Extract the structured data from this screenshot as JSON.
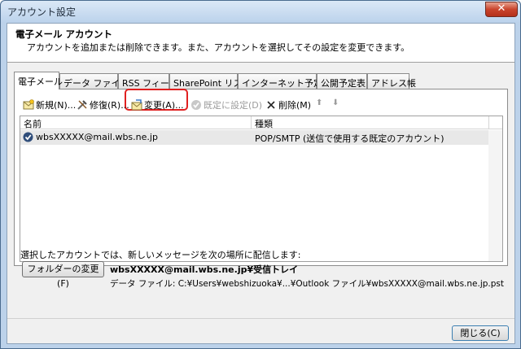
{
  "window": {
    "title": "アカウント設定",
    "close_glyph": "✕"
  },
  "header": {
    "title": "電子メール アカウント",
    "description": "アカウントを追加または削除できます。また、アカウントを選択してその設定を変更できます。"
  },
  "tabs": [
    {
      "label": "電子メール",
      "active": true
    },
    {
      "label": "データ ファイル"
    },
    {
      "label": "RSS フィード"
    },
    {
      "label": "SharePoint リスト"
    },
    {
      "label": "インターネット予定表"
    },
    {
      "label": "公開予定表"
    },
    {
      "label": "アドレス帳"
    }
  ],
  "toolbar": {
    "new": "新規(N)...",
    "repair": "修復(R)...",
    "change": "変更(A)...",
    "set_default": "既定に設定(D)",
    "delete": "削除(M)",
    "move_up": "⬆",
    "move_down": "⬇"
  },
  "list": {
    "columns": [
      "名前",
      "種類"
    ],
    "rows": [
      {
        "name": "wbsXXXXX@mail.wbs.ne.jp",
        "type": "POP/SMTP (送信で使用する既定のアカウント)"
      }
    ]
  },
  "delivery": {
    "label": "選択したアカウントでは、新しいメッセージを次の場所に配信します:",
    "change_folder_button": "フォルダーの変更(F)",
    "folder": "wbsXXXXX@mail.wbs.ne.jp¥受信トレイ",
    "data_file": "データ ファイル: C:¥Users¥webshizuoka¥...¥Outlook ファイル¥wbsXXXXX@mail.wbs.ne.jp.pst"
  },
  "footer": {
    "close_button": "閉じる(C)"
  },
  "colors": {
    "highlight": "#e02020",
    "title_bar": "#bcd3ec",
    "close_button": "#c9442c"
  }
}
